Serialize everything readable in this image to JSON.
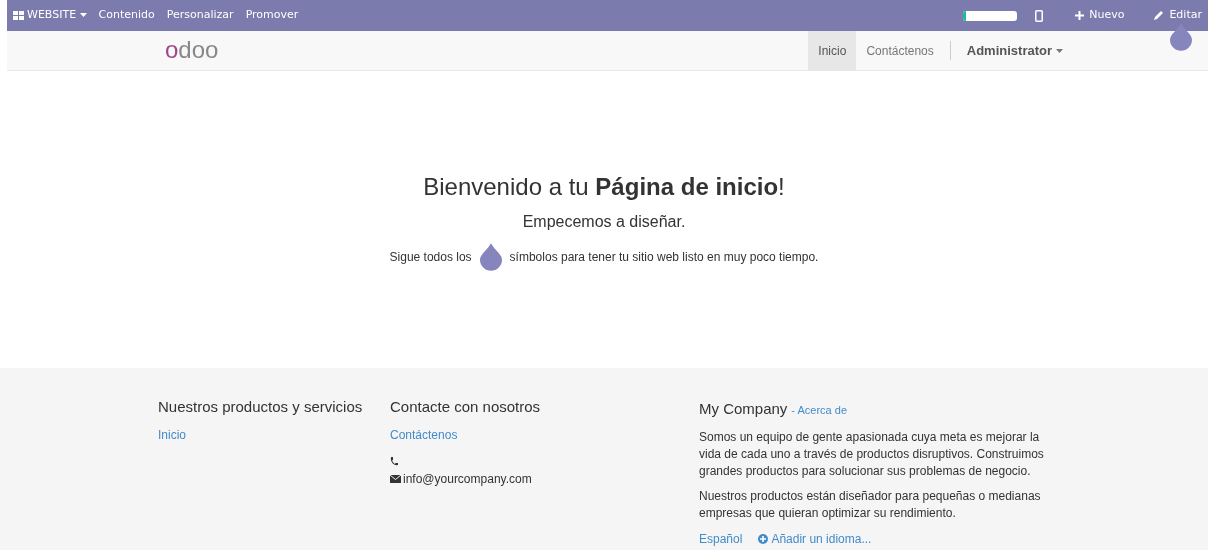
{
  "top_bar": {
    "app_menu": "WEBSITE",
    "menu": [
      "Contenido",
      "Personalizar",
      "Promover"
    ],
    "progress": {
      "level": 0.05
    },
    "new": "Nuevo",
    "edit": "Editar"
  },
  "header": {
    "logo": "odoo",
    "nav": [
      {
        "label": "Inicio",
        "selected": true
      },
      {
        "label": "Contáctenos",
        "selected": false
      }
    ],
    "user": "Administrator"
  },
  "hero": {
    "title": "Bienvenido a tu **Página de inicio**!",
    "subtitle": "Empecemos a diseñar.",
    "hint_before": "Sigue todos los",
    "hint_after": "símbolos para tener tu sitio web listo en muy poco tiempo."
  },
  "footer": {
    "products": {
      "title": "Nuestros productos y servicios",
      "links": [
        "Inicio"
      ]
    },
    "contact": {
      "title": "Contacte con nosotros",
      "link": "Contáctenos",
      "email": "info@yourcompany.com"
    },
    "company": {
      "title": "My Company",
      "about": "- Acerca de",
      "paragraphs": [
        "Somos un equipo de gente apasionada cuya meta es mejorar la vida de cada uno a través de productos disruptivos. Construimos grandes productos para solucionar sus problemas de negocio.",
        "Nuestros productos están diseñador para pequeñas o medianas empresas que quieran optimizar su rendimiento."
      ],
      "language": "Español",
      "add_language": "Añadir un idioma..."
    }
  }
}
